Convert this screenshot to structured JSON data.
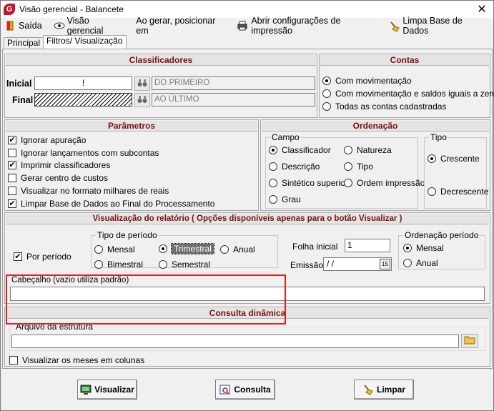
{
  "window": {
    "title": "Visão gerencial - Balancete",
    "logo_letter": "G",
    "close_glyph": "✕"
  },
  "menu": [
    {
      "id": "saida",
      "label": "Saída",
      "icon": "exit-door-icon"
    },
    {
      "id": "visao",
      "label": "Visão gerencial",
      "icon": "eye-icon"
    },
    {
      "id": "posicionar",
      "label": "Ao gerar, posicionar em",
      "icon": ""
    },
    {
      "id": "config",
      "label": "Abrir configurações de impressão",
      "icon": "printer-icon"
    },
    {
      "id": "limpa",
      "label": "Limpa Base de Dados",
      "icon": "broom-icon"
    }
  ],
  "tabs": {
    "principal": "Principal",
    "filtros": "Filtros/ Visualização"
  },
  "classificadores": {
    "title": "Classificadores",
    "inicial_label": "Inicial",
    "inicial_value": "!",
    "inicial_desc": "DO PRIMEIRO",
    "final_label": "Final",
    "final_desc": "AO ÚLTIMO"
  },
  "contas": {
    "title": "Contas",
    "options": [
      "Com movimentação",
      "Com movimentação e saldos iguais a zero",
      "Todas as contas cadastradas"
    ],
    "selected": 0
  },
  "parametros": {
    "title": "Parâmetros",
    "items": [
      {
        "label": "Ignorar apuração",
        "checked": true
      },
      {
        "label": "Ignorar lançamentos com subcontas",
        "checked": false
      },
      {
        "label": "Imprimir classificadores",
        "checked": true
      },
      {
        "label": "Gerar centro de custos",
        "checked": false
      },
      {
        "label": "Visualizar no formato milhares de reais",
        "checked": false
      },
      {
        "label": "Limpar Base de Dados ao Final do Processamento",
        "checked": true
      }
    ]
  },
  "ordenacao": {
    "title": "Ordenação",
    "campo_label": "Campo",
    "campo": [
      "Classificador",
      "Natureza",
      "Descrição",
      "Tipo",
      "Sintético superior",
      "Ordem impressão",
      "Grau"
    ],
    "campo_selected": "Classificador",
    "tipo_label": "Tipo",
    "tipo": [
      "Crescente",
      "Decrescente"
    ],
    "tipo_selected": "Crescente"
  },
  "visualizacao": {
    "title": "Visualização do relatório ( Opções disponíveis apenas para o botão Visualizar )",
    "por_periodo_label": "Por período",
    "por_periodo_checked": true,
    "tipo_periodo_label": "Tipo de período",
    "periodos": [
      "Mensal",
      "Trimestral",
      "Anual",
      "Bimestral",
      "Semestral"
    ],
    "periodo_selected": "Trimestral",
    "folha_label": "Folha inicial",
    "folha_value": "1",
    "emissao_label": "Emissão",
    "emissao_value": " /  /",
    "calendar_text": "15",
    "ord_periodo_label": "Ordenação período",
    "ord_periodo": [
      "Mensal",
      "Anual"
    ],
    "ord_periodo_selected": "Mensal",
    "cabecalho_label": "Cabeçalho (vazio utiliza padrão)",
    "cabecalho_value": ""
  },
  "consulta": {
    "title": "Consulta dinâmica",
    "arquivo_label": "Arquivo da estrutura",
    "arquivo_value": "",
    "meses_colunas_label": "Visualizar os meses em colunas",
    "meses_colunas_checked": false
  },
  "buttons": {
    "visualizar": "Visualizar",
    "consulta": "Consulta",
    "limpar": "Limpar"
  },
  "colors": {
    "group_title": "#7a1010",
    "highlight": "#e02020",
    "logo": "#c8102e"
  }
}
